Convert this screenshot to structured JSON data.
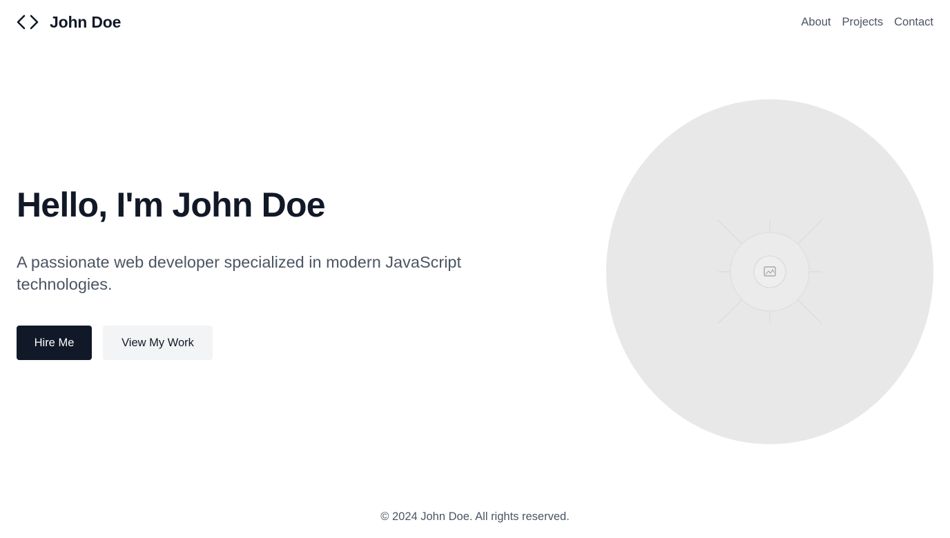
{
  "header": {
    "brand_name": "John Doe",
    "brand_icon": "code-brackets-icon",
    "nav": [
      {
        "label": "About"
      },
      {
        "label": "Projects"
      },
      {
        "label": "Contact"
      }
    ]
  },
  "hero": {
    "title": "Hello, I'm John Doe",
    "subtitle": "A passionate web developer specialized in modern JavaScript technologies.",
    "primary_button": "Hire Me",
    "secondary_button": "View My Work",
    "image_icon": "image-placeholder-icon"
  },
  "footer": {
    "copyright": "© 2024 John Doe. All rights reserved."
  },
  "colors": {
    "primary": "#111827",
    "muted_text": "#4b5563",
    "secondary_bg": "#f3f4f6",
    "placeholder_bg": "#e8e8e8"
  }
}
